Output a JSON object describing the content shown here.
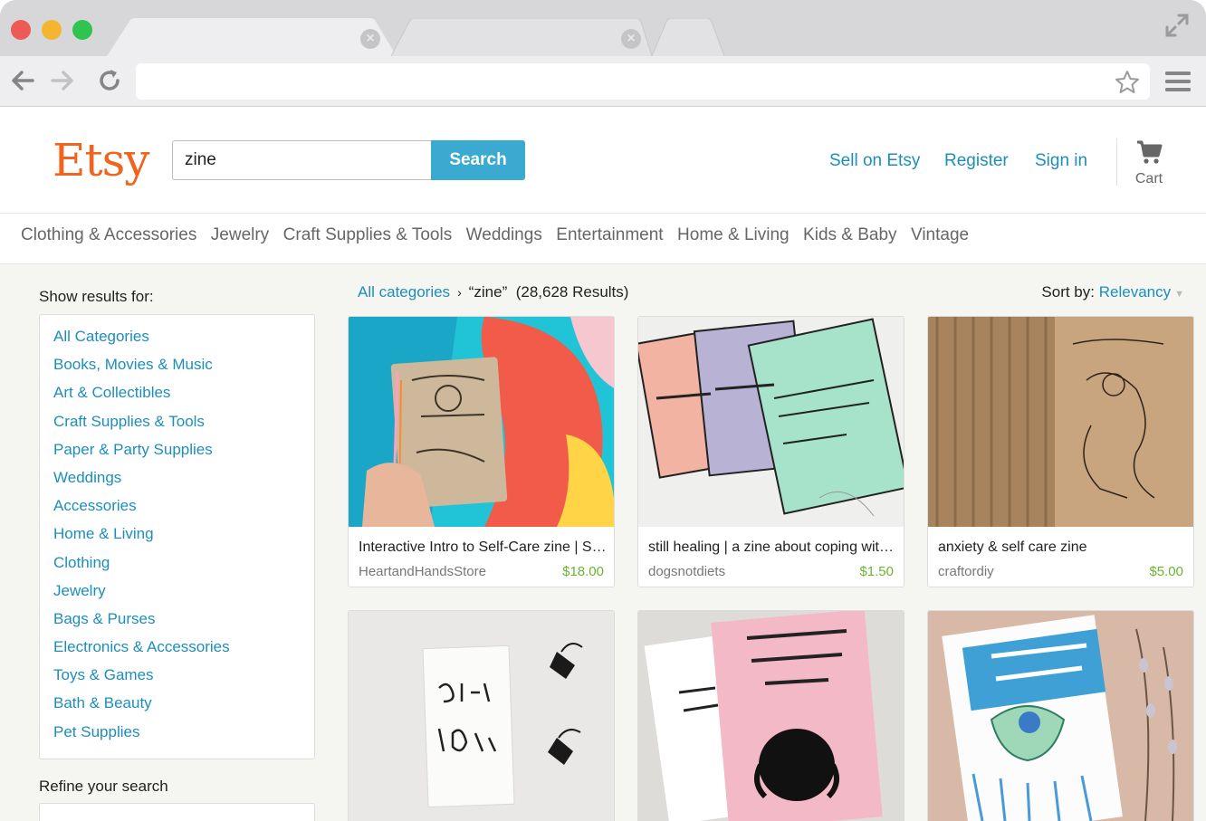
{
  "browser": {
    "url": "",
    "icons": [
      "back-arrow-icon",
      "forward-arrow-icon",
      "reload-icon",
      "star-icon",
      "menu-icon",
      "fullscreen-icon",
      "close-icon"
    ]
  },
  "header": {
    "logo": "Etsy",
    "search": {
      "value": "zine",
      "button": "Search"
    },
    "links": {
      "sell": "Sell on Etsy",
      "register": "Register",
      "signin": "Sign in"
    },
    "cart": {
      "label": "Cart",
      "icon": "cart-icon"
    }
  },
  "catnav": [
    "Clothing & Accessories",
    "Jewelry",
    "Craft Supplies & Tools",
    "Weddings",
    "Entertainment",
    "Home & Living",
    "Kids & Baby",
    "Vintage"
  ],
  "sidebar": {
    "title": "Show results for:",
    "categories": [
      "All Categories",
      "Books, Movies & Music",
      "Art & Collectibles",
      "Craft Supplies & Tools",
      "Paper & Party Supplies",
      "Weddings",
      "Accessories",
      "Home & Living",
      "Clothing",
      "Jewelry",
      "Bags & Purses",
      "Electronics & Accessories",
      "Toys & Games",
      "Bath & Beauty",
      "Pet Supplies"
    ],
    "refine_title": "Refine your search"
  },
  "results": {
    "breadcrumb_root": "All categories",
    "breadcrumb_sep": "›",
    "query": "“zine”",
    "count": "(28,628 Results)",
    "sort_label": "Sort by:",
    "sort_value": "Relevancy"
  },
  "listings": [
    {
      "title": "Interactive Intro to Self-Care zine | Self-Care Practice Guide",
      "shop": "HeartandHandsStore",
      "price": "$18.00"
    },
    {
      "title": "still healing | a zine about coping with and healing from self harm",
      "shop": "dogsnotdiets",
      "price": "$1.50"
    },
    {
      "title": "anxiety & self care zine",
      "shop": "craftordiy",
      "price": "$5.00"
    },
    {
      "title": "",
      "shop": "",
      "price": ""
    },
    {
      "title": "",
      "shop": "",
      "price": ""
    },
    {
      "title": "",
      "shop": "",
      "price": ""
    }
  ],
  "colors": {
    "brand": "#f1641e",
    "link": "#1d8ebb",
    "search_button": "#3aaad0",
    "price": "#6bb332",
    "page_bg": "#f5f5f1"
  }
}
